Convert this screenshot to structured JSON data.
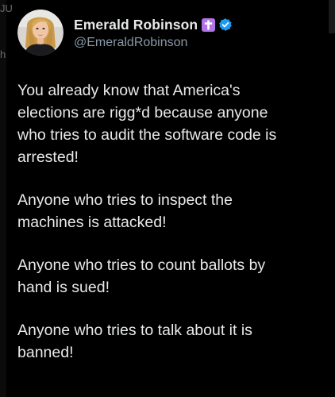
{
  "edge": {
    "top_left_glyph": "JU",
    "left_glyph": "h"
  },
  "header": {
    "display_name": "Emerald Robinson",
    "handle": "@EmeraldRobinson",
    "cross_badge_color": "#b174e6",
    "verified_color": "#1d9bf0"
  },
  "icons": {
    "cross": "cross-icon",
    "verified": "verified-badge-icon",
    "avatar": "profile-photo"
  },
  "tweet": {
    "paragraphs": [
      "You already know that America's\nelections are rigg*d because anyone\nwho tries to audit the software code is\narrested!",
      "Anyone who tries to inspect the\nmachines is attacked!",
      "Anyone who tries to count ballots by\nhand is sued!",
      "Anyone who tries to talk about it is\nbanned!"
    ]
  },
  "colors": {
    "background": "#000000",
    "text": "#e7e9ea",
    "secondary_text": "#8b98a5"
  }
}
